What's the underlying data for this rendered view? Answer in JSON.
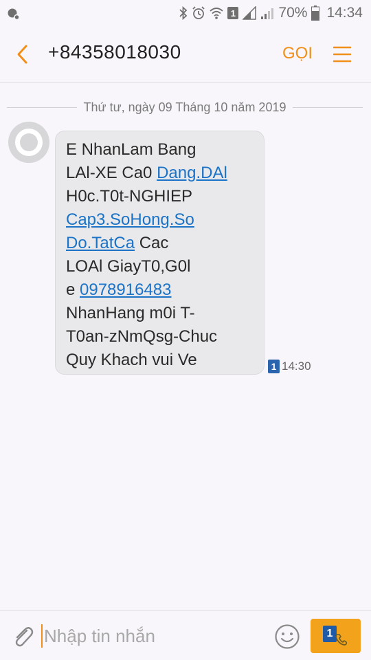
{
  "status_bar": {
    "battery_text": "70%",
    "time": "14:34",
    "sim_number": "1"
  },
  "header": {
    "title": "+84358018030",
    "call_label": "GỌI"
  },
  "conversation": {
    "date_separator": "Thứ tư, ngày 09 Tháng 10 năm 2019",
    "message": {
      "lines": [
        [
          {
            "text": "E NhanLam Bang",
            "link": false
          }
        ],
        [
          {
            "text": "LAl-XE Ca0 ",
            "link": false
          },
          {
            "text": "Dang.DAl",
            "link": true
          }
        ],
        [
          {
            "text": "H0c.T0t-NGHIEP",
            "link": false
          }
        ],
        [
          {
            "text": "Cap3.SoHong.So",
            "link": true
          }
        ],
        [
          {
            "text": "Do.TatCa",
            "link": true
          },
          {
            "text": " Cac",
            "link": false
          }
        ],
        [
          {
            "text": "LOAl GiayT0,G0l",
            "link": false
          }
        ],
        [
          {
            "text": "e ",
            "link": false
          },
          {
            "text": "0978916483",
            "link": true
          }
        ],
        [
          {
            "text": "NhanHang m0i T-",
            "link": false
          }
        ],
        [
          {
            "text": "T0an-zNmQsg-Chuc",
            "link": false
          }
        ],
        [
          {
            "text": "Quy Khach vui Ve",
            "link": false
          }
        ]
      ],
      "sim_number": "1",
      "time": "14:30"
    }
  },
  "composer": {
    "placeholder": "Nhập tin nhắn",
    "value": "",
    "send_sim_number": "1"
  },
  "colors": {
    "accent": "#f0901b",
    "link": "#1b73c7",
    "bubble": "#e9e9eb",
    "background": "#f8f6fa"
  }
}
